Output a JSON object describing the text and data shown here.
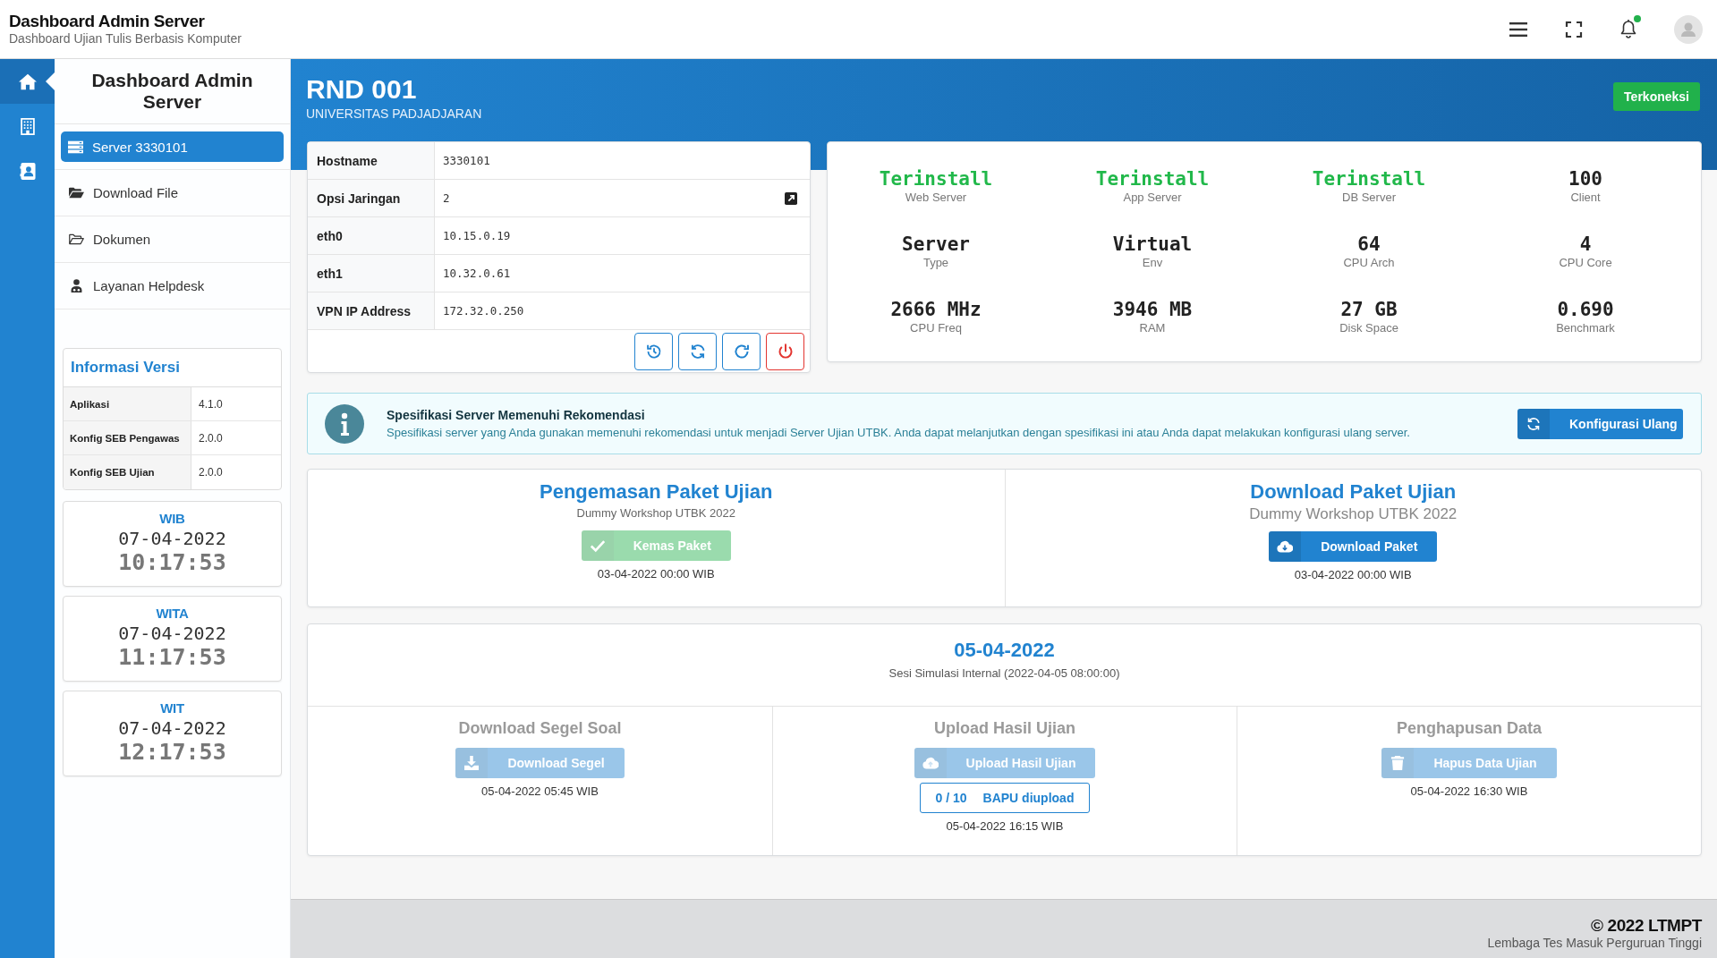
{
  "header": {
    "title": "Dashboard Admin Server",
    "subtitle": "Dashboard Ujian Tulis Berbasis Komputer",
    "notification": true
  },
  "icon_bar": {
    "items": [
      {
        "kind": "home",
        "selected": true
      },
      {
        "kind": "building",
        "selected": false
      },
      {
        "kind": "contact",
        "selected": false
      }
    ]
  },
  "sidebar": {
    "title": "Dashboard Admin Server",
    "items": [
      {
        "kind": "server",
        "label": "Server 3330101",
        "selected": true
      },
      {
        "kind": "folder-open",
        "label": "Download File",
        "selected": false
      },
      {
        "kind": "folder",
        "label": "Dokumen",
        "selected": false
      },
      {
        "kind": "helpdesk",
        "label": "Layanan Helpdesk",
        "selected": false
      }
    ]
  },
  "version_info": {
    "title": "Informasi Versi",
    "rows": [
      {
        "label": "Aplikasi",
        "value": "4.1.0"
      },
      {
        "label": "Konfig SEB Pengawas",
        "value": "2.0.0"
      },
      {
        "label": "Konfig SEB Ujian",
        "value": "2.0.0"
      }
    ]
  },
  "clocks": [
    {
      "zone": "WIB",
      "date": "07-04-2022",
      "time": "10:17:53"
    },
    {
      "zone": "WITA",
      "date": "07-04-2022",
      "time": "11:17:53"
    },
    {
      "zone": "WIT",
      "date": "07-04-2022",
      "time": "12:17:53"
    }
  ],
  "page_header": {
    "title": "RND 001",
    "subtitle": "UNIVERSITAS PADJADJARAN",
    "status": "Terkoneksi"
  },
  "server_table": {
    "rows": [
      {
        "label": "Hostname",
        "value": "3330101",
        "editable": false
      },
      {
        "label": "Opsi Jaringan",
        "value": "2",
        "editable": true
      },
      {
        "label": "eth0",
        "value": "10.15.0.19",
        "editable": false
      },
      {
        "label": "eth1",
        "value": "10.32.0.61",
        "editable": false
      },
      {
        "label": "VPN IP Address",
        "value": "172.32.0.250",
        "editable": false
      }
    ],
    "actions": [
      {
        "kind": "history"
      },
      {
        "kind": "sync"
      },
      {
        "kind": "redo"
      },
      {
        "kind": "power"
      }
    ]
  },
  "stats": [
    {
      "kind": "status",
      "value": "Terinstall",
      "label": "Web Server"
    },
    {
      "kind": "status",
      "value": "Terinstall",
      "label": "App Server"
    },
    {
      "kind": "status",
      "value": "Terinstall",
      "label": "DB Server"
    },
    {
      "kind": "plain",
      "value": "100",
      "label": "Client"
    },
    {
      "kind": "plain",
      "value": "Server",
      "label": "Type"
    },
    {
      "kind": "plain",
      "value": "Virtual",
      "label": "Env"
    },
    {
      "kind": "plain",
      "value": "64",
      "label": "CPU Arch"
    },
    {
      "kind": "plain",
      "value": "4",
      "label": "CPU Core"
    },
    {
      "kind": "plain",
      "value": "2666 MHz",
      "label": "CPU Freq"
    },
    {
      "kind": "plain",
      "value": "3946 MB",
      "label": "RAM"
    },
    {
      "kind": "plain",
      "value": "27 GB",
      "label": "Disk Space"
    },
    {
      "kind": "plain",
      "value": "0.690",
      "label": "Benchmark"
    }
  ],
  "alert": {
    "title": "Spesifikasi Server Memenuhi Rekomendasi",
    "message": "Spesifikasi server yang Anda gunakan memenuhi rekomendasi untuk menjadi Server Ujian UTBK. Anda dapat melanjutkan dengan spesifikasi ini atau Anda dapat melakukan konfigurasi ulang server.",
    "button": "Konfigurasi Ulang"
  },
  "packages": [
    {
      "kind": "pack",
      "title": "Pengemasan Paket Ujian",
      "subtitle": "Dummy Workshop UTBK 2022",
      "button": "Kemas Paket",
      "disabled": true,
      "date": "03-04-2022 00:00 WIB"
    },
    {
      "kind": "download",
      "title": "Download Paket Ujian",
      "subtitle": "Dummy Workshop UTBK 2022",
      "button": "Download Paket",
      "disabled": false,
      "date": "03-04-2022 00:00 WIB"
    }
  ],
  "session": {
    "date": "05-04-2022",
    "name": "Sesi Simulasi Internal (2022-04-05 08:00:00)",
    "steps": [
      {
        "kind": "download",
        "title": "Download Segel Soal",
        "button": "Download Segel",
        "disabled": true,
        "date": "05-04-2022 05:45 WIB"
      },
      {
        "kind": "upload",
        "title": "Upload Hasil Ujian",
        "button": "Upload Hasil Ujian",
        "disabled": true,
        "counter": {
          "value": "0 / 10",
          "label": "BAPU diupload"
        },
        "date": "05-04-2022 16:15 WIB"
      },
      {
        "kind": "delete",
        "title": "Penghapusan Data",
        "button": "Hapus Data Ujian",
        "disabled": true,
        "date": "05-04-2022 16:30 WIB"
      }
    ]
  },
  "footer": {
    "copyright": "© 2022 LTMPT",
    "organization": "Lembaga Tes Masuk Perguruan Tinggi"
  }
}
